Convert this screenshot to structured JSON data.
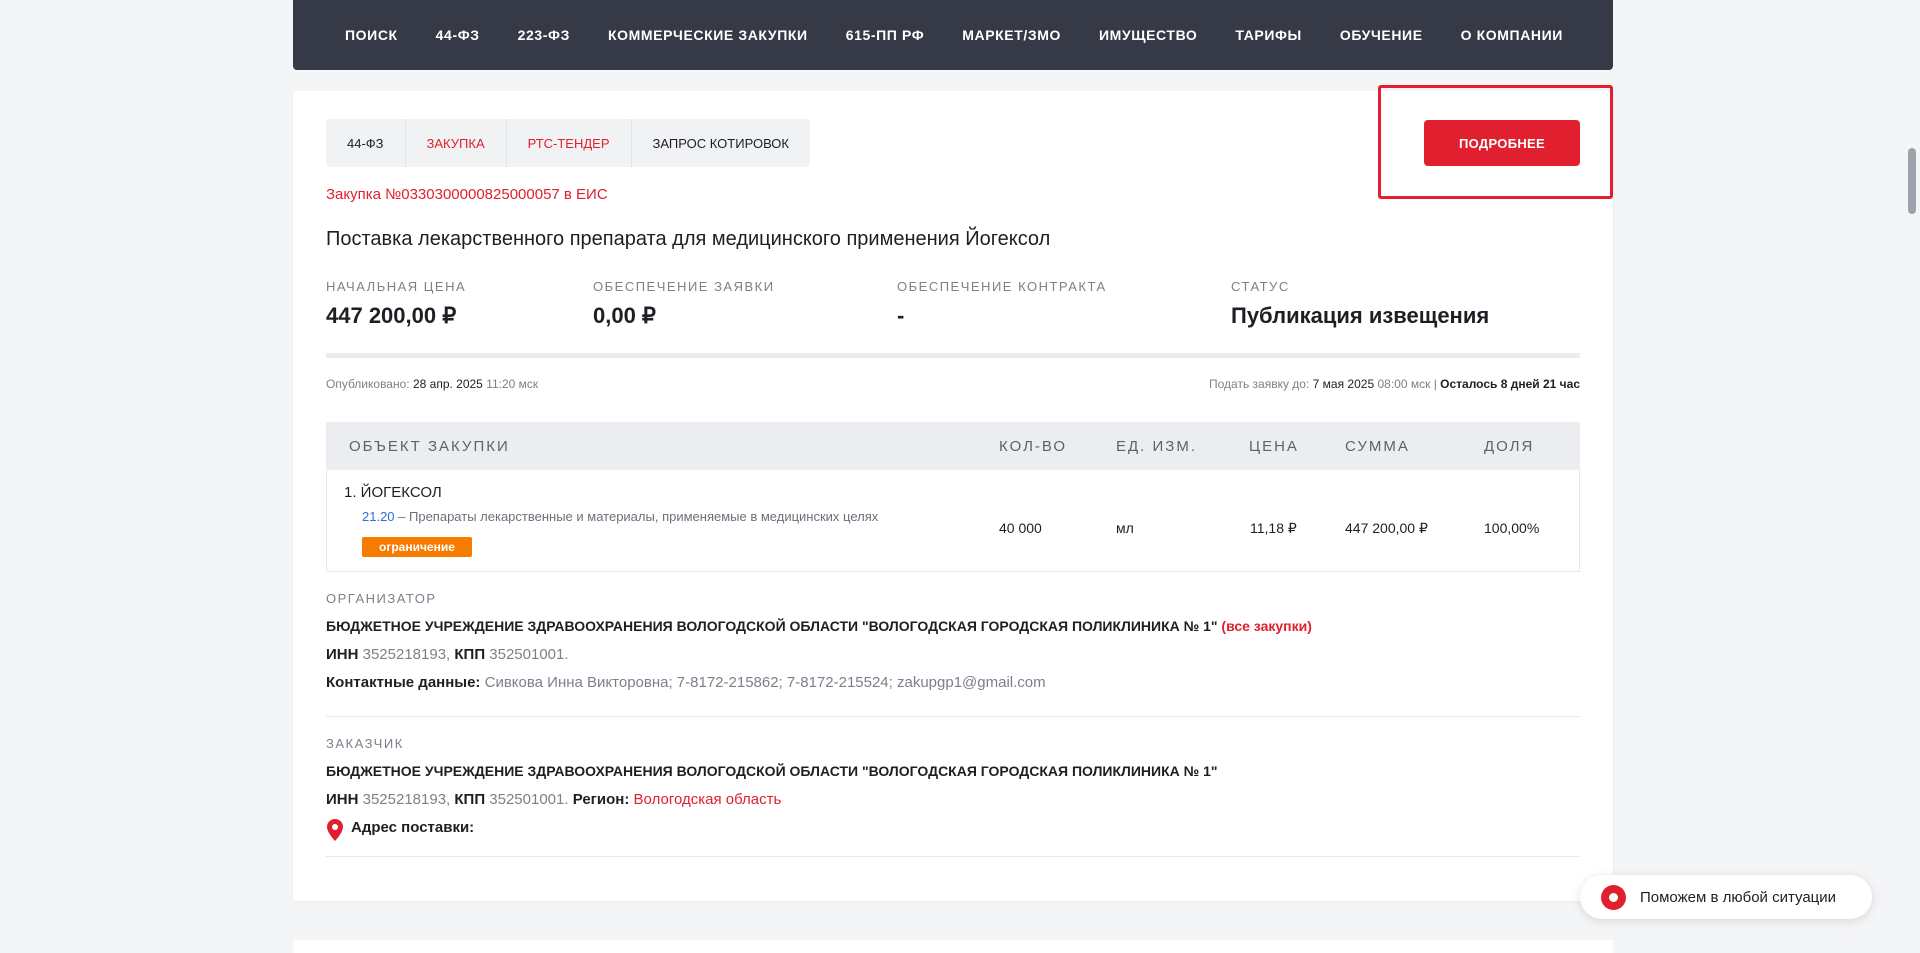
{
  "nav": [
    "ПОИСК",
    "44-ФЗ",
    "223-ФЗ",
    "КОММЕРЧЕСКИЕ ЗАКУПКИ",
    "615-ПП РФ",
    "МАРКЕТ/ЗМО",
    "ИМУЩЕСТВО",
    "ТАРИФЫ",
    "ОБУЧЕНИЕ",
    "О КОМПАНИИ"
  ],
  "tags": [
    "44-ФЗ",
    "ЗАКУПКА",
    "РТС-ТЕНДЕР",
    "ЗАПРОС КОТИРОВОК"
  ],
  "more_button": "ПОДРОБНЕЕ",
  "eis_link": "Закупка №0330300000825000057 в ЕИС",
  "title": "Поставка лекарственного препарата для медицинского применения Йогексол",
  "stats": {
    "price_label": "НАЧАЛЬНАЯ ЦЕНА",
    "price": "447 200,00 ₽",
    "bid_label": "ОБЕСПЕЧЕНИЕ ЗАЯВКИ",
    "bid": "0,00 ₽",
    "contract_label": "ОБЕСПЕЧЕНИЕ КОНТРАКТА",
    "contract": "-",
    "status_label": "СТАТУС",
    "status": "Публикация извещения"
  },
  "published": {
    "label": "Опубликовано:",
    "date": "28 апр. 2025",
    "time": "11:20 мск"
  },
  "deadline": {
    "label": "Подать заявку до:",
    "date": "7 мая 2025",
    "time": "08:00 мск",
    "sep": "|",
    "remaining": "Осталось 8 дней 21 час"
  },
  "table": {
    "headers": [
      "ОБЪЕКТ ЗАКУПКИ",
      "КОЛ-ВО",
      "ЕД. ИЗМ.",
      "ЦЕНА",
      "СУММА",
      "ДОЛЯ"
    ],
    "row": {
      "name": "1. ЙОГЕКСОЛ",
      "okpd_code": "21.20",
      "okpd_text": " – Препараты лекарственные и материалы, применяемые в медицинских целях",
      "badge": "ограничение",
      "qty": "40 000",
      "unit": "мл",
      "price": "11,18 ₽",
      "sum": "447 200,00 ₽",
      "share": "100,00%"
    }
  },
  "organizer": {
    "label": "ОРГАНИЗАТОР",
    "name": "БЮДЖЕТНОЕ УЧРЕЖДЕНИЕ ЗДРАВООХРАНЕНИЯ ВОЛОГОДСКОЙ ОБЛАСТИ \"ВОЛОГОДСКАЯ ГОРОДСКАЯ ПОЛИКЛИНИКА № 1\"",
    "all_link": "(все закупки)",
    "inn_label": "ИНН",
    "inn": "3525218193,",
    "kpp_label": "КПП",
    "kpp": "352501001.",
    "contacts_label": "Контактные данные:",
    "contacts": "Сивкова Инна Викторовна; 7-8172-215862; 7-8172-215524; zakupgp1@gmail.com"
  },
  "customer": {
    "label": "ЗАКАЗЧИК",
    "name": "БЮДЖЕТНОЕ УЧРЕЖДЕНИЕ ЗДРАВООХРАНЕНИЯ ВОЛОГОДСКОЙ ОБЛАСТИ \"ВОЛОГОДСКАЯ ГОРОДСКАЯ ПОЛИКЛИНИКА № 1\"",
    "inn_label": "ИНН",
    "inn": "3525218193,",
    "kpp_label": "КПП",
    "kpp": "352501001.",
    "region_label": "Регион:",
    "region": "Вологодская область",
    "address_label": "Адрес поставки:"
  },
  "helper": "Поможем в любой ситуации",
  "icons": {
    "pin": "map-pin-icon",
    "chat": "chat-icon"
  },
  "colors": {
    "accent": "#e0202f",
    "nav_bg": "#363a47",
    "badge": "#f57c00",
    "code_link": "#2f6cd6"
  }
}
